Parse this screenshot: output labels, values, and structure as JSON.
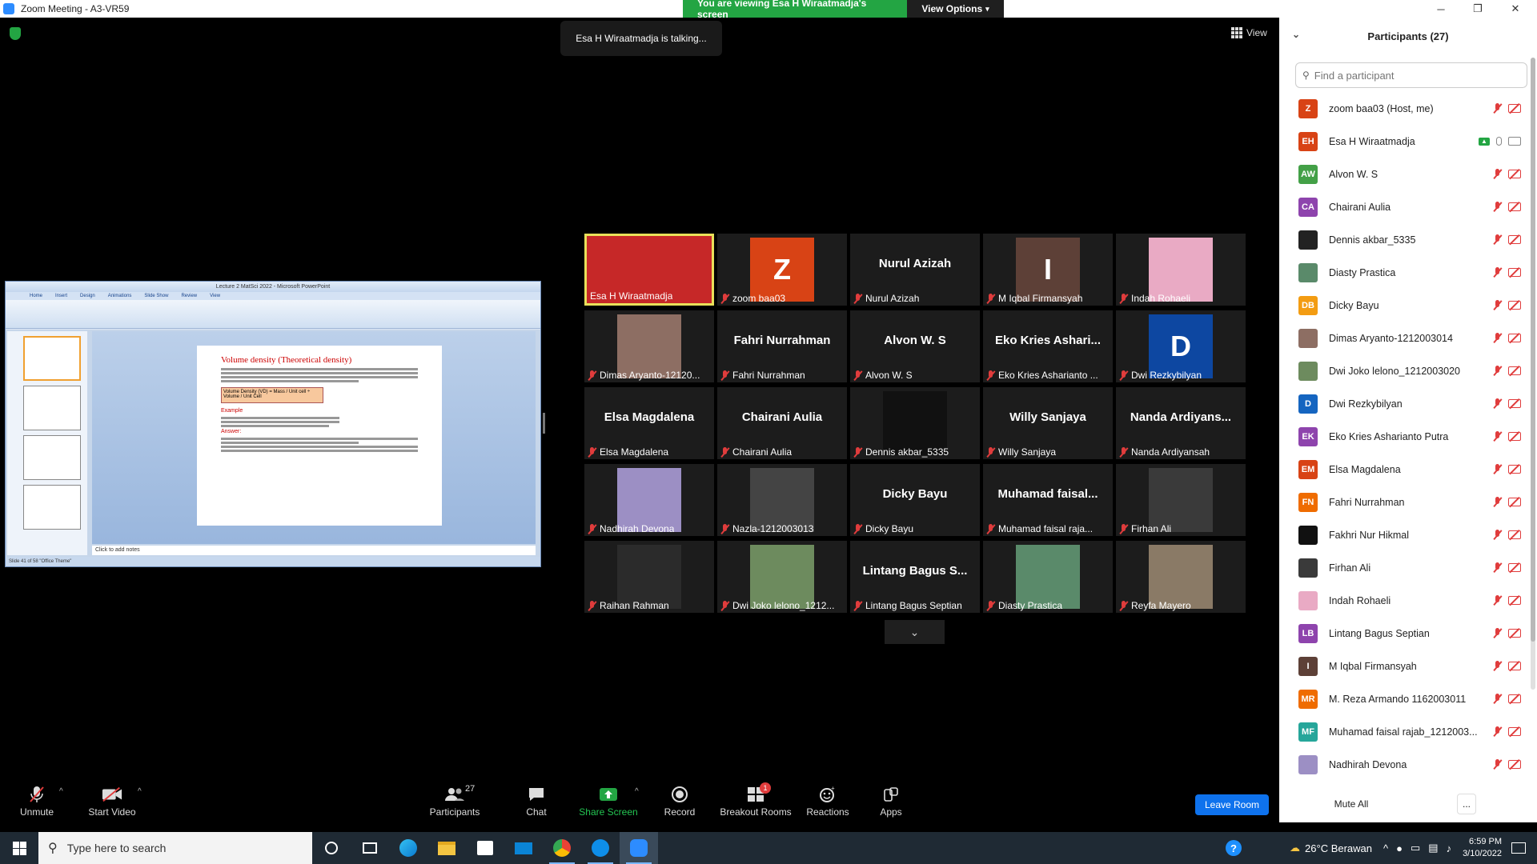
{
  "window": {
    "title": "Zoom Meeting - A3-VR59",
    "minimize": "─",
    "restore": "❐",
    "close": "✕"
  },
  "banner": {
    "message": "You are viewing Esa H Wiraatmadja's screen",
    "view_options": "View Options"
  },
  "talking_indicator": "Esa H Wiraatmadja is talking...",
  "view_label": "View",
  "shared_screen": {
    "app_title": "Lecture 2 MatSci 2022 - Microsoft PowerPoint",
    "ribbon_tabs": [
      "Home",
      "Insert",
      "Design",
      "Animations",
      "Slide Show",
      "Review",
      "View"
    ],
    "slide_title": "Volume density (Theoretical density)",
    "formula_text": "Volume Density (VD) = Mass / Unit cell ÷ Volume / Unit Cell",
    "example_label": "Example",
    "answer_label": "Answer:",
    "notes_placeholder": "Click to add notes",
    "status_text": "Slide 41 of 58   \"Office Theme\""
  },
  "video_tiles": [
    {
      "name": "Esa H Wiraatmadja",
      "type": "video",
      "bg": "#c62828",
      "active": true
    },
    {
      "name": "zoom baa03",
      "type": "letter",
      "letter": "Z",
      "bg": "#d84315"
    },
    {
      "name": "Nurul Azizah",
      "type": "text",
      "display": "Nurul Azizah"
    },
    {
      "name": "M Iqbal Firmansyah",
      "type": "letter",
      "letter": "I",
      "bg": "#5d4037"
    },
    {
      "name": "Indah Rohaeli",
      "type": "video",
      "bg": "#e9aac4"
    },
    {
      "name": "Dimas Aryanto-12120...",
      "type": "video",
      "bg": "#8d6e63"
    },
    {
      "name": "Fahri Nurrahman",
      "type": "text",
      "display": "Fahri Nurrahman"
    },
    {
      "name": "Alvon W. S",
      "type": "text",
      "display": "Alvon W. S"
    },
    {
      "name": "Eko Kries Asharianto ...",
      "type": "text",
      "display": "Eko Kries Ashari..."
    },
    {
      "name": "Dwi Rezkybilyan",
      "type": "letter",
      "letter": "D",
      "bg": "#0d47a1"
    },
    {
      "name": "Elsa Magdalena",
      "type": "text",
      "display": "Elsa Magdalena"
    },
    {
      "name": "Chairani Aulia",
      "type": "text",
      "display": "Chairani Aulia"
    },
    {
      "name": "Dennis akbar_5335",
      "type": "video",
      "bg": "#111111"
    },
    {
      "name": "Willy Sanjaya",
      "type": "text",
      "display": "Willy Sanjaya"
    },
    {
      "name": "Nanda Ardiyansah",
      "type": "text",
      "display": "Nanda Ardiyans..."
    },
    {
      "name": "Nadhirah Devona",
      "type": "video",
      "bg": "#9c8fc4"
    },
    {
      "name": "Nazla-1212003013",
      "type": "video",
      "bg": "#444444"
    },
    {
      "name": "Dicky Bayu",
      "type": "text",
      "display": "Dicky Bayu"
    },
    {
      "name": "Muhamad faisal raja...",
      "type": "text",
      "display": "Muhamad faisal..."
    },
    {
      "name": "Firhan Ali",
      "type": "video",
      "bg": "#3a3a3a"
    },
    {
      "name": "Raihan Rahman",
      "type": "video",
      "bg": "#2b2b2b"
    },
    {
      "name": "Dwi Joko lelono_1212...",
      "type": "video",
      "bg": "#6d8b5e"
    },
    {
      "name": "Lintang Bagus Septian",
      "type": "text",
      "display": "Lintang Bagus S..."
    },
    {
      "name": "Diasty Prastica",
      "type": "video",
      "bg": "#5a8a6a"
    },
    {
      "name": "Reyfa Mayero",
      "type": "video",
      "bg": "#8a7a66"
    }
  ],
  "participants_panel": {
    "title": "Participants (27)",
    "search_placeholder": "Find a participant",
    "mute_all": "Mute All",
    "more": "...",
    "list": [
      {
        "initials": "Z",
        "name": "zoom baa03 (Host, me)",
        "color": "#d84315",
        "state": "muted"
      },
      {
        "initials": "EH",
        "name": "Esa H Wiraatmadja",
        "color": "#d84315",
        "state": "sharing"
      },
      {
        "initials": "AW",
        "name": "Alvon W. S",
        "color": "#43a047",
        "state": "muted"
      },
      {
        "initials": "CA",
        "name": "Chairani Aulia",
        "color": "#8e44ad",
        "state": "muted"
      },
      {
        "initials": "",
        "name": "Dennis akbar_5335",
        "color": "#222222",
        "state": "muted"
      },
      {
        "initials": "",
        "name": "Diasty Prastica",
        "color": "#5a8a6a",
        "state": "muted"
      },
      {
        "initials": "DB",
        "name": "Dicky Bayu",
        "color": "#f39c12",
        "state": "muted"
      },
      {
        "initials": "",
        "name": "Dimas Aryanto-1212003014",
        "color": "#8d6e63",
        "state": "muted"
      },
      {
        "initials": "",
        "name": "Dwi Joko lelono_1212003020",
        "color": "#6d8b5e",
        "state": "muted"
      },
      {
        "initials": "D",
        "name": "Dwi Rezkybilyan",
        "color": "#1565c0",
        "state": "muted"
      },
      {
        "initials": "EK",
        "name": "Eko Kries Asharianto Putra",
        "color": "#8e44ad",
        "state": "muted"
      },
      {
        "initials": "EM",
        "name": "Elsa Magdalena",
        "color": "#d84315",
        "state": "muted"
      },
      {
        "initials": "FN",
        "name": "Fahri Nurrahman",
        "color": "#ef6c00",
        "state": "muted"
      },
      {
        "initials": "",
        "name": "Fakhri Nur Hikmal",
        "color": "#111111",
        "state": "muted"
      },
      {
        "initials": "",
        "name": "Firhan Ali",
        "color": "#3a3a3a",
        "state": "muted"
      },
      {
        "initials": "",
        "name": "Indah Rohaeli",
        "color": "#e9aac4",
        "state": "muted"
      },
      {
        "initials": "LB",
        "name": "Lintang Bagus Septian",
        "color": "#8e44ad",
        "state": "muted"
      },
      {
        "initials": "I",
        "name": "M Iqbal Firmansyah",
        "color": "#5d4037",
        "state": "muted"
      },
      {
        "initials": "MR",
        "name": "M. Reza Armando 1162003011",
        "color": "#ef6c00",
        "state": "muted"
      },
      {
        "initials": "MF",
        "name": "Muhamad faisal rajab_1212003...",
        "color": "#26a69a",
        "state": "muted"
      },
      {
        "initials": "",
        "name": "Nadhirah Devona",
        "color": "#9c8fc4",
        "state": "muted"
      }
    ]
  },
  "toolbar": {
    "unmute": "Unmute",
    "start_video": "Start Video",
    "participants": "Participants",
    "participants_count": "27",
    "chat": "Chat",
    "share_screen": "Share Screen",
    "record": "Record",
    "breakout_rooms": "Breakout Rooms",
    "breakout_badge": "1",
    "reactions": "Reactions",
    "apps": "Apps",
    "leave_room": "Leave Room"
  },
  "taskbar": {
    "search_placeholder": "Type here to search",
    "weather": "26°C  Berawan",
    "time": "6:59 PM",
    "date": "3/10/2022"
  },
  "colors": {
    "accent_blue": "#0e72ed",
    "share_green": "#23a543",
    "muted_red": "#e03c3c",
    "active_speaker": "#e9e05a"
  }
}
